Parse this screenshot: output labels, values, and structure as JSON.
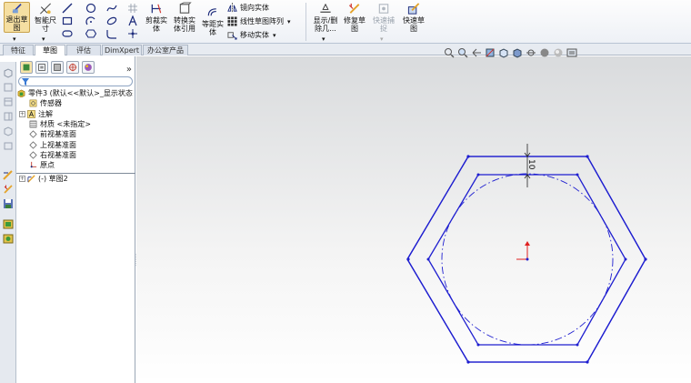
{
  "ribbon": {
    "exit_sketch": "退出草\n图",
    "smart_dim": "智能尺\n寸",
    "trim": "剪裁实\n体",
    "convert": "转换实\n体引用",
    "offset": "等距实\n体",
    "mirror": "镜向实体",
    "linear_pattern": "线性草图阵列",
    "move": "移动实体",
    "display_delete": "显示/删\n除几...",
    "repair": "修复草\n图",
    "quick_snap": "快速捕\n捉",
    "quick_sketch": "快速草\n图"
  },
  "tabs": [
    "特征",
    "草图",
    "评估",
    "DimXpert",
    "办公室产品"
  ],
  "active_tab": 1,
  "tree": {
    "part": "零件3 (默认<<默认>_显示状态",
    "sensors": "传感器",
    "annotations": "注解",
    "material": "材质 <未指定>",
    "front_plane": "前视基准面",
    "top_plane": "上视基准面",
    "right_plane": "右视基准面",
    "origin": "原点",
    "sketch": "(-) 草图2"
  },
  "sketch": {
    "dimension": "10",
    "line_color": "#1f1fd0",
    "origin_color": "#e02020"
  }
}
